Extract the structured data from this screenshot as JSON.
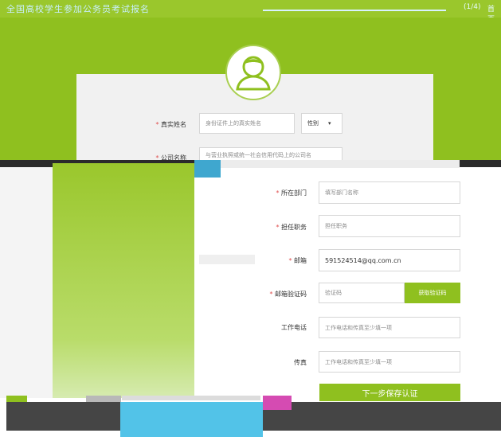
{
  "header": {
    "title": "全国高校学生参加公务员考试报名",
    "right_a": "(1/4)",
    "right_b": "首页"
  },
  "form": {
    "real_name": {
      "label": "真实姓名",
      "placeholder": "身份证件上的真实姓名",
      "gender": "性别"
    },
    "company": {
      "label": "公司名称",
      "placeholder": "与营业执照或统一社会信用代码上的公司名"
    },
    "department": {
      "label": "所在部门",
      "placeholder": "填写部门名称"
    },
    "position": {
      "label": "担任职务",
      "placeholder": "担任职务"
    },
    "email": {
      "label": "邮箱",
      "value": "591524514@qq.com.cn"
    },
    "email_code": {
      "label": "邮箱验证码",
      "placeholder": "验证码",
      "button": "获取验证码"
    },
    "work_phone": {
      "label": "工作电话",
      "placeholder": "工作电话和传真至少填一项"
    },
    "fax": {
      "label": "传真",
      "placeholder": "工作电话和传真至少填一项"
    },
    "submit": "下一步保存认证"
  },
  "colors": {
    "brand_green": "#8fc01f",
    "required_star": "#e04e4e"
  }
}
